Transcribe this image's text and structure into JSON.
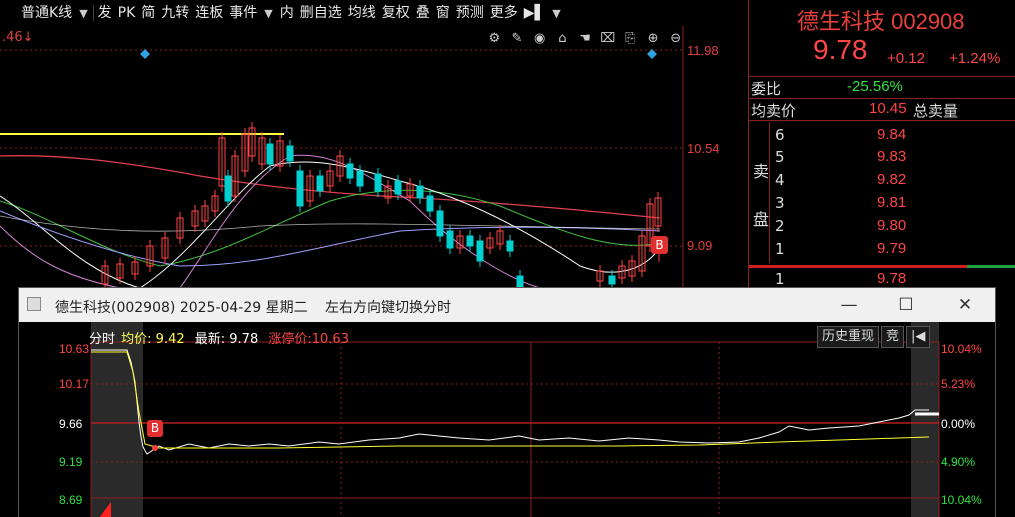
{
  "toolbar": {
    "items": [
      "普通K线",
      "发",
      "PK",
      "简",
      "九转",
      "连板",
      "事件",
      "内",
      "删自选",
      "均线",
      "复权",
      "叠",
      "窗",
      "预测",
      "更多"
    ]
  },
  "chart": {
    "corner_label": ".46↓",
    "y_labels": [
      "11.98",
      "10.54",
      "9.09"
    ],
    "b_marker": "B"
  },
  "quote": {
    "name": "德生科技 002908",
    "price": "9.78",
    "change": "+0.12",
    "change_pct": "+1.24%",
    "wei_bi_label": "委比",
    "wei_bi_value": "-25.56%",
    "avg_sell_label": "均卖价",
    "avg_sell_value": "10.45",
    "total_sell_label": "总卖量",
    "sell_side_label": [
      "卖",
      "盘"
    ],
    "asks": [
      {
        "level": "6",
        "price": "9.84"
      },
      {
        "level": "5",
        "price": "9.83"
      },
      {
        "level": "4",
        "price": "9.82"
      },
      {
        "level": "3",
        "price": "9.81"
      },
      {
        "level": "2",
        "price": "9.80"
      },
      {
        "level": "1",
        "price": "9.79"
      }
    ],
    "bid1_level": "1",
    "bid1_price": "9.78"
  },
  "popup": {
    "title": "德生科技(002908) 2025-04-29 星期二",
    "hint": "左右方向键切换分时",
    "legend_fenshi": "分时",
    "legend_avg": "均价: 9.42",
    "legend_latest": "最新: 9.78",
    "legend_limit": "涨停价:10.63",
    "btn_history": "历史重现",
    "btn_bid": "竞",
    "b_marker": "B",
    "left_prices": [
      "10.63",
      "10.17",
      "9.66",
      "9.19",
      "8.69"
    ],
    "right_pcts": [
      "10.04%",
      "5.23%",
      "0.00%",
      "4.90%",
      "10.04%"
    ]
  },
  "colors": {
    "up": "#ff4545",
    "down": "#00d0d0",
    "ma_yellow": "#ffff40",
    "panel_border": "#8a2020"
  }
}
